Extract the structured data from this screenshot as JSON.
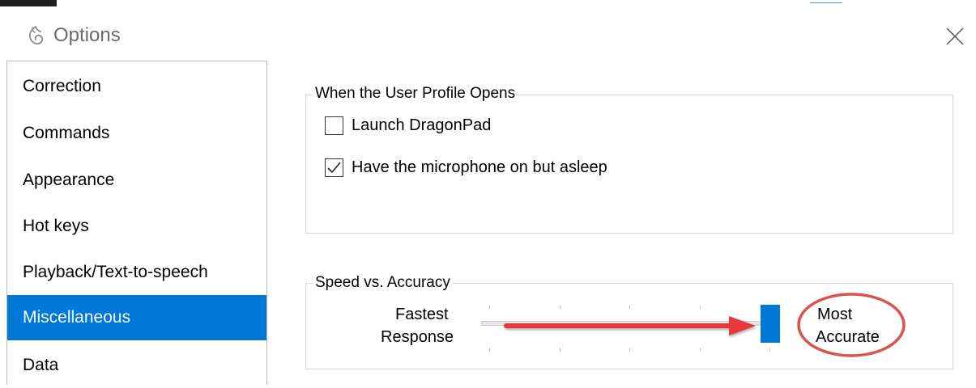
{
  "window": {
    "title": "Options",
    "icon": "dragon-icon",
    "close_icon": "close-icon"
  },
  "sidebar": {
    "items": [
      {
        "label": "Correction",
        "selected": false
      },
      {
        "label": "Commands",
        "selected": false
      },
      {
        "label": "Appearance",
        "selected": false
      },
      {
        "label": "Hot keys",
        "selected": false
      },
      {
        "label": "Playback/Text-to-speech",
        "selected": false
      },
      {
        "label": "Miscellaneous",
        "selected": true
      },
      {
        "label": "Data",
        "selected": false
      }
    ]
  },
  "profile_group": {
    "title": "When the User Profile Opens",
    "options": [
      {
        "label": "Launch DragonPad",
        "checked": false
      },
      {
        "label": "Have the microphone on but asleep",
        "checked": true
      }
    ]
  },
  "speed_group": {
    "title": "Speed vs. Accuracy",
    "left_label_line1": "Fastest",
    "left_label_line2": "Response",
    "right_label_line1": "Most",
    "right_label_line2": "Accurate",
    "slider_value_fraction": 1.0
  },
  "colors": {
    "accent": "#0078d7",
    "annotation_arrow": "#e8383d",
    "annotation_circle": "#d9534f"
  }
}
